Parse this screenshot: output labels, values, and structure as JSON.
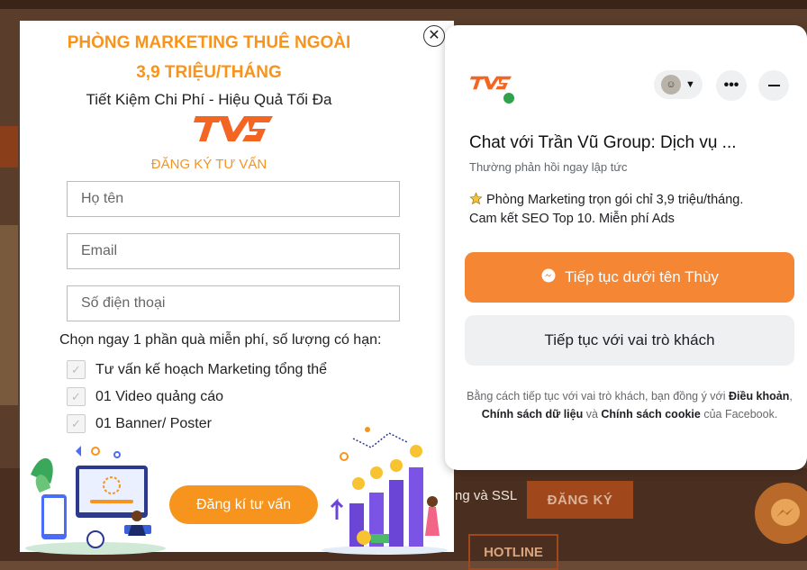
{
  "background": {
    "ssl_text": "ng và SSL",
    "register_button": "ĐĂNG KÝ",
    "hotline_button": "HOTLINE"
  },
  "popup": {
    "title_line1": "PHÒNG MARKETING THUÊ NGOÀI",
    "title_line2": "3,9 TRIỆU/THÁNG",
    "subtitle": "Tiết Kiệm Chi Phí - Hiệu Quả Tối Đa",
    "logo_text": "TVG",
    "register_heading": "ĐĂNG KÝ TƯ VẤN",
    "fields": {
      "name_placeholder": "Họ tên",
      "email_placeholder": "Email",
      "phone_placeholder": "Số điện thoại"
    },
    "gift_heading": "Chọn ngay 1 phần quà miễn phí, số lượng có hạn:",
    "gifts": [
      "Tư vấn kế hoạch Marketing tổng thể",
      "01 Video quảng cáo",
      "01 Banner/ Poster"
    ],
    "submit_label": "Đăng kí tư vấn",
    "close_icon": "close-circle-icon"
  },
  "chat": {
    "title": "Chat với Trần Vũ Group: Dịch vụ ...",
    "status": "Thường phản hồi ngay lập tức",
    "message_line1": "Phòng Marketing trọn gói chỉ 3,9 triệu/tháng.",
    "message_line2": "Cam kết SEO Top 10. Miễn phí Ads",
    "primary_button": "Tiếp tục dưới tên Thùy",
    "secondary_button": "Tiếp tục với vai trò khách",
    "terms": {
      "part1": "Bằng cách tiếp tục với vai trò khách, bạn đồng ý với ",
      "link1": "Điều khoản",
      "sep1": ", ",
      "link2": "Chính sách dữ liệu",
      "sep2": " và ",
      "link3": "Chính sách cookie",
      "part2": " của Facebook."
    }
  },
  "colors": {
    "orange": "#f7941d",
    "messenger_orange": "#f58634",
    "online_green": "#31a24c"
  }
}
